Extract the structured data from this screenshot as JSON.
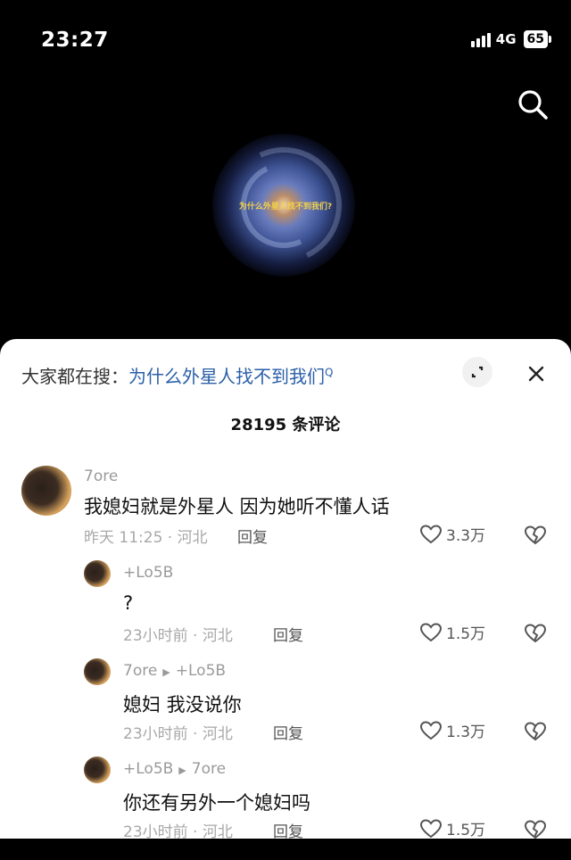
{
  "status_bar": {
    "time": "23:27",
    "network": "4G",
    "battery": "65"
  },
  "video": {
    "caption": "为什么外星人找不到我们?"
  },
  "panel": {
    "hot_search_prefix": "大家都在搜：",
    "hot_search_keyword": "为什么外星人找不到我们",
    "hot_search_mark": "Q",
    "comment_count": "28195 条评论"
  },
  "comments": [
    {
      "user": "7ore",
      "reply_to": "",
      "text": "我媳妇就是外星人 因为她听不懂人话",
      "time": "昨天 11:25 · 河北",
      "reply": "回复",
      "likes": "3.3万"
    },
    {
      "user": "+Lo5B",
      "reply_to": "",
      "text": "?",
      "time": "23小时前 · 河北",
      "reply": "回复",
      "likes": "1.5万"
    },
    {
      "user": "7ore",
      "reply_to": "+Lo5B",
      "text": "媳妇 我没说你",
      "time": "23小时前 · 河北",
      "reply": "回复",
      "likes": "1.3万"
    },
    {
      "user": "+Lo5B",
      "reply_to": "7ore",
      "text": "你还有另外一个媳妇吗",
      "time": "23小时前 · 河北",
      "reply": "回复",
      "likes": "1.5万"
    }
  ]
}
